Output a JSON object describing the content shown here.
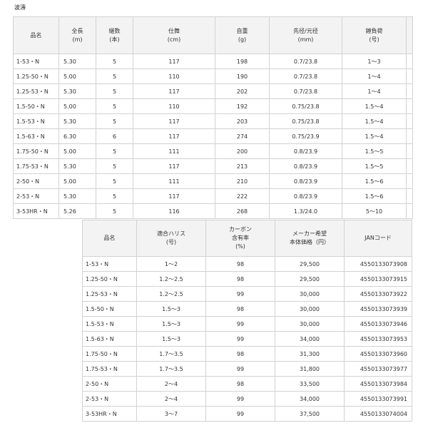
{
  "page_title": "波濤",
  "spec_table": {
    "headers": [
      {
        "line1": "品名",
        "line2": ""
      },
      {
        "line1": "全長",
        "line2": "(m)"
      },
      {
        "line1": "継数",
        "line2": "(本)"
      },
      {
        "line1": "仕舞",
        "line2": "(cm)"
      },
      {
        "line1": "自重",
        "line2": "(g)"
      },
      {
        "line1": "先径/元径",
        "line2": "(mm)"
      },
      {
        "line1": "錘負荷",
        "line2": "(号)"
      },
      {
        "line1": "",
        "line2": ""
      }
    ],
    "rows": [
      [
        "1-53・N",
        "5.30",
        "5",
        "117",
        "198",
        "0.7/23.8",
        "1〜3",
        ""
      ],
      [
        "1.25-50・N",
        "5.00",
        "5",
        "110",
        "190",
        "0.7/23.8",
        "1〜4",
        ""
      ],
      [
        "1.25-53・N",
        "5.30",
        "5",
        "117",
        "202",
        "0.7/23.8",
        "1〜4",
        ""
      ],
      [
        "1.5-50・N",
        "5.00",
        "5",
        "110",
        "192",
        "0.75/23.8",
        "1.5〜4",
        ""
      ],
      [
        "1.5-53・N",
        "5.30",
        "5",
        "117",
        "203",
        "0.75/23.8",
        "1.5〜4",
        ""
      ],
      [
        "1.5-63・N",
        "6.30",
        "6",
        "117",
        "274",
        "0.75/23.9",
        "1.5〜4",
        ""
      ],
      [
        "1.75-50・N",
        "5.00",
        "5",
        "111",
        "200",
        "0.8/23.9",
        "1.5〜5",
        ""
      ],
      [
        "1.75-53・N",
        "5.30",
        "5",
        "117",
        "213",
        "0.8/23.9",
        "1.5〜5",
        ""
      ],
      [
        "2-50・N",
        "5.00",
        "5",
        "111",
        "210",
        "0.8/23.9",
        "1.5〜6",
        ""
      ],
      [
        "2-53・N",
        "5.30",
        "5",
        "117",
        "222",
        "0.8/23.9",
        "1.5〜6",
        ""
      ],
      [
        "3-53HR・N",
        "5.26",
        "5",
        "116",
        "268",
        "1.3/24.0",
        "5〜10",
        ""
      ]
    ]
  },
  "price_table": {
    "headers": [
      {
        "line1": "品名",
        "line2": "",
        "line3": ""
      },
      {
        "line1": "適合ハリス",
        "line2": "(号)",
        "line3": ""
      },
      {
        "line1": "カーボン",
        "line2": "含有率",
        "line3": "(%)"
      },
      {
        "line1": "メーカー希望",
        "line2": "本体価格（円）",
        "line3": ""
      },
      {
        "line1": "JANコード",
        "line2": "",
        "line3": ""
      }
    ],
    "rows": [
      [
        "1-53・N",
        "1〜2",
        "98",
        "29,500",
        "4550133073908"
      ],
      [
        "1.25-50・N",
        "1.2〜2.5",
        "98",
        "29,500",
        "4550133073915"
      ],
      [
        "1.25-53・N",
        "1.2〜2.5",
        "99",
        "30,000",
        "4550133073922"
      ],
      [
        "1.5-50・N",
        "1.5〜3",
        "98",
        "30,000",
        "4550133073939"
      ],
      [
        "1.5-53・N",
        "1.5〜3",
        "99",
        "30,000",
        "4550133073946"
      ],
      [
        "1.5-63・N",
        "1.5〜3",
        "99",
        "34,000",
        "4550133073953"
      ],
      [
        "1.75-50・N",
        "1.7〜3.5",
        "98",
        "31,300",
        "4550133073960"
      ],
      [
        "1.75-53・N",
        "1.7〜3.5",
        "99",
        "31,800",
        "4550133073977"
      ],
      [
        "2-50・N",
        "2〜4",
        "98",
        "33,500",
        "4550133073984"
      ],
      [
        "2-53・N",
        "2〜4",
        "99",
        "34,000",
        "4550133073991"
      ],
      [
        "3-53HR・N",
        "3〜7",
        "99",
        "37,500",
        "4550133074004"
      ]
    ]
  }
}
